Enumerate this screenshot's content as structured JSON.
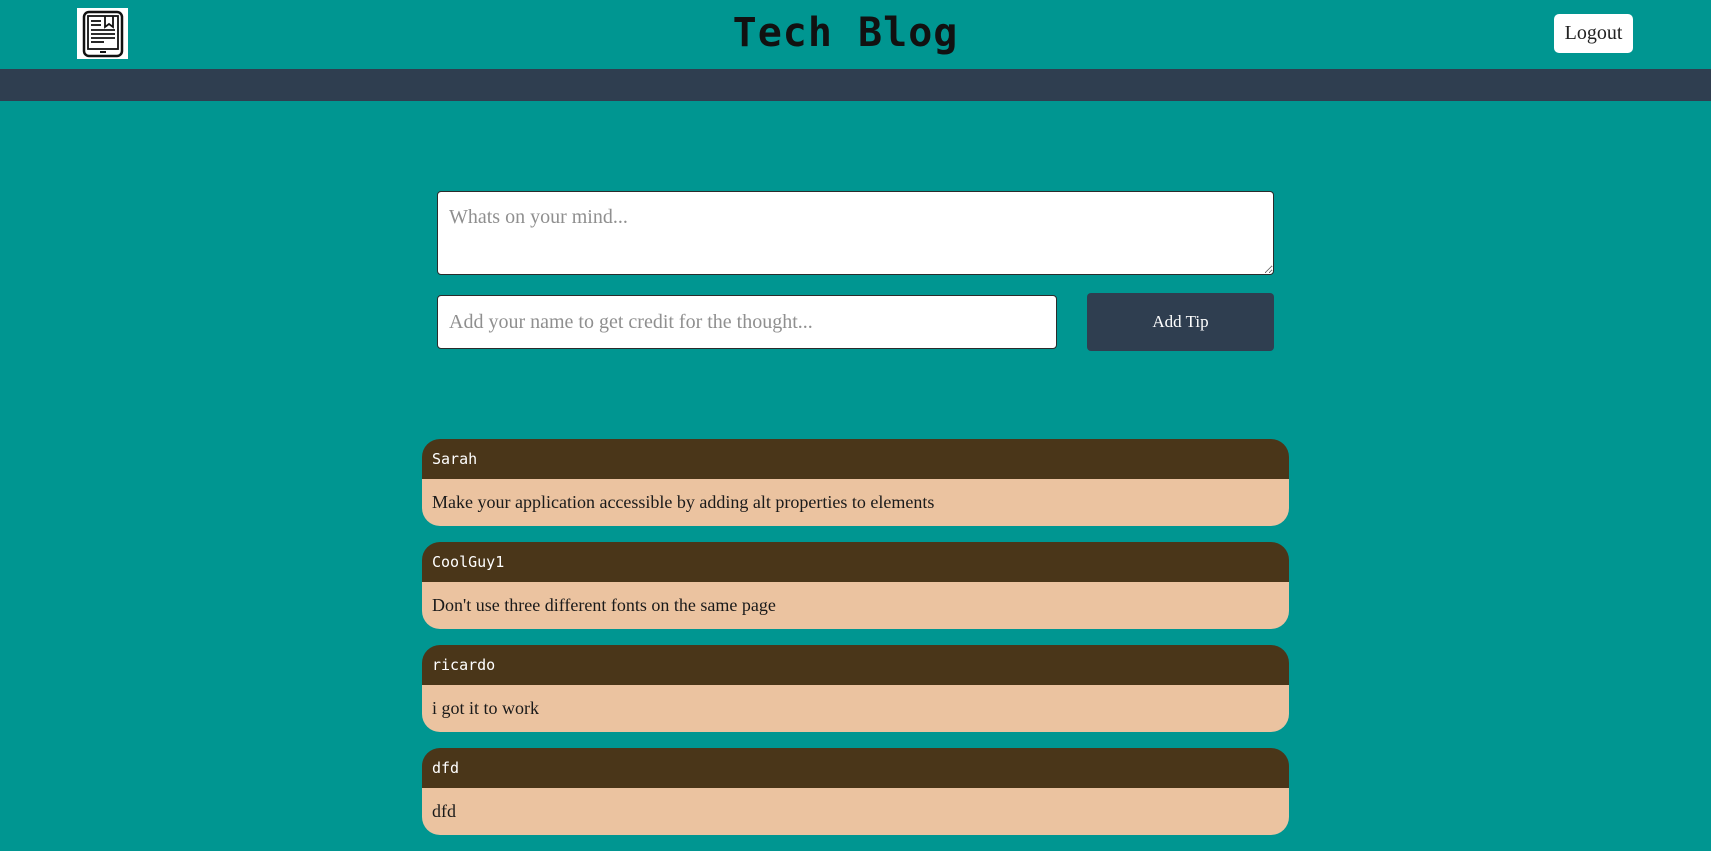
{
  "header": {
    "title": "Tech Blog",
    "logout_label": "Logout",
    "logo_icon": "tablet-bookmark-icon"
  },
  "form": {
    "thought_placeholder": "Whats on your mind...",
    "name_placeholder": "Add your name to get credit for the thought...",
    "submit_label": "Add Tip"
  },
  "tips": [
    {
      "author": "Sarah",
      "text": "Make your application accessible by adding alt properties to elements"
    },
    {
      "author": "CoolGuy1",
      "text": "Don't use three different fonts on the same page"
    },
    {
      "author": "ricardo",
      "text": "i got it to work"
    },
    {
      "author": "dfd",
      "text": "dfd"
    }
  ],
  "colors": {
    "page_bg": "#009691",
    "nav_bg": "#2f3e50",
    "card_header_bg": "#4a3619",
    "card_body_bg": "#ebc3a0"
  }
}
